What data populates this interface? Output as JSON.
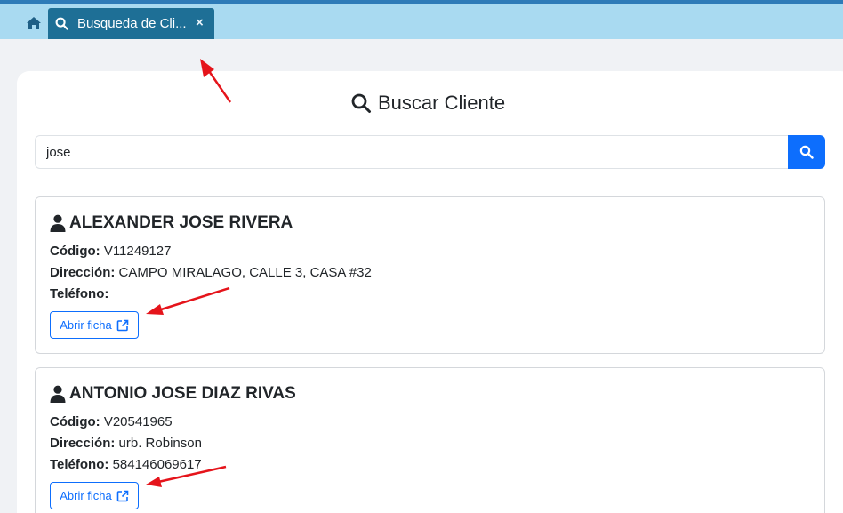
{
  "tabs": [
    {
      "label": "Busqueda de Cli...",
      "close": "×"
    }
  ],
  "page": {
    "title": "Buscar Cliente"
  },
  "search": {
    "value": "jose",
    "placeholder": ""
  },
  "labels": {
    "code": "Código:",
    "address": "Dirección:",
    "phone": "Teléfono:",
    "open_button": "Abrir ficha"
  },
  "results": [
    {
      "name": "ALEXANDER JOSE RIVERA",
      "code": "V11249127",
      "address": "CAMPO MIRALAGO, CALLE 3, CASA #32",
      "phone": ""
    },
    {
      "name": "ANTONIO JOSE DIAZ RIVAS",
      "code": "V20541965",
      "address": "urb. Robinson",
      "phone": "584146069617"
    }
  ],
  "colors": {
    "tabbar": "#a9daf1",
    "active_tab": "#1e6f96",
    "primary": "#0d6efd",
    "annotation_arrow": "#e5141b"
  }
}
